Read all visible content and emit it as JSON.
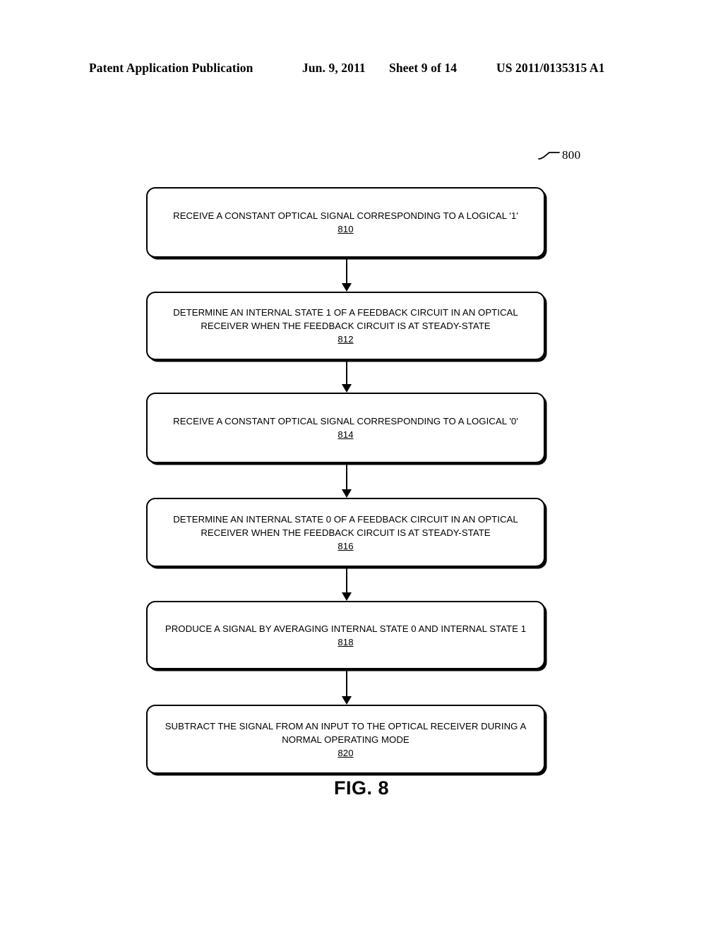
{
  "header": {
    "publication": "Patent Application Publication",
    "date": "Jun. 9, 2011",
    "sheet": "Sheet 9 of 14",
    "patent_number": "US 2011/0135315 A1"
  },
  "figure": {
    "reference_number": "800",
    "caption": "FIG. 8",
    "line_color": "#000000",
    "background_color": "#ffffff"
  },
  "flowchart": {
    "steps": [
      {
        "id": "810",
        "text": "RECEIVE A CONSTANT OPTICAL SIGNAL CORRESPONDING TO A LOGICAL '1'",
        "ref": "810"
      },
      {
        "id": "812",
        "text": "DETERMINE AN INTERNAL STATE 1 OF A FEEDBACK CIRCUIT IN AN OPTICAL RECEIVER WHEN THE FEEDBACK CIRCUIT IS AT STEADY-STATE",
        "ref": "812"
      },
      {
        "id": "814",
        "text": "RECEIVE A CONSTANT OPTICAL SIGNAL CORRESPONDING TO A LOGICAL '0'",
        "ref": "814"
      },
      {
        "id": "816",
        "text": "DETERMINE AN INTERNAL STATE 0 OF A FEEDBACK CIRCUIT IN AN OPTICAL RECEIVER WHEN THE FEEDBACK CIRCUIT IS AT STEADY-STATE",
        "ref": "816"
      },
      {
        "id": "818",
        "text": "PRODUCE A SIGNAL BY AVERAGING INTERNAL STATE 0 AND INTERNAL STATE 1",
        "ref": "818"
      },
      {
        "id": "820",
        "text": "SUBTRACT THE SIGNAL FROM AN INPUT TO THE OPTICAL RECEIVER DURING A NORMAL OPERATING MODE",
        "ref": "820"
      }
    ]
  }
}
